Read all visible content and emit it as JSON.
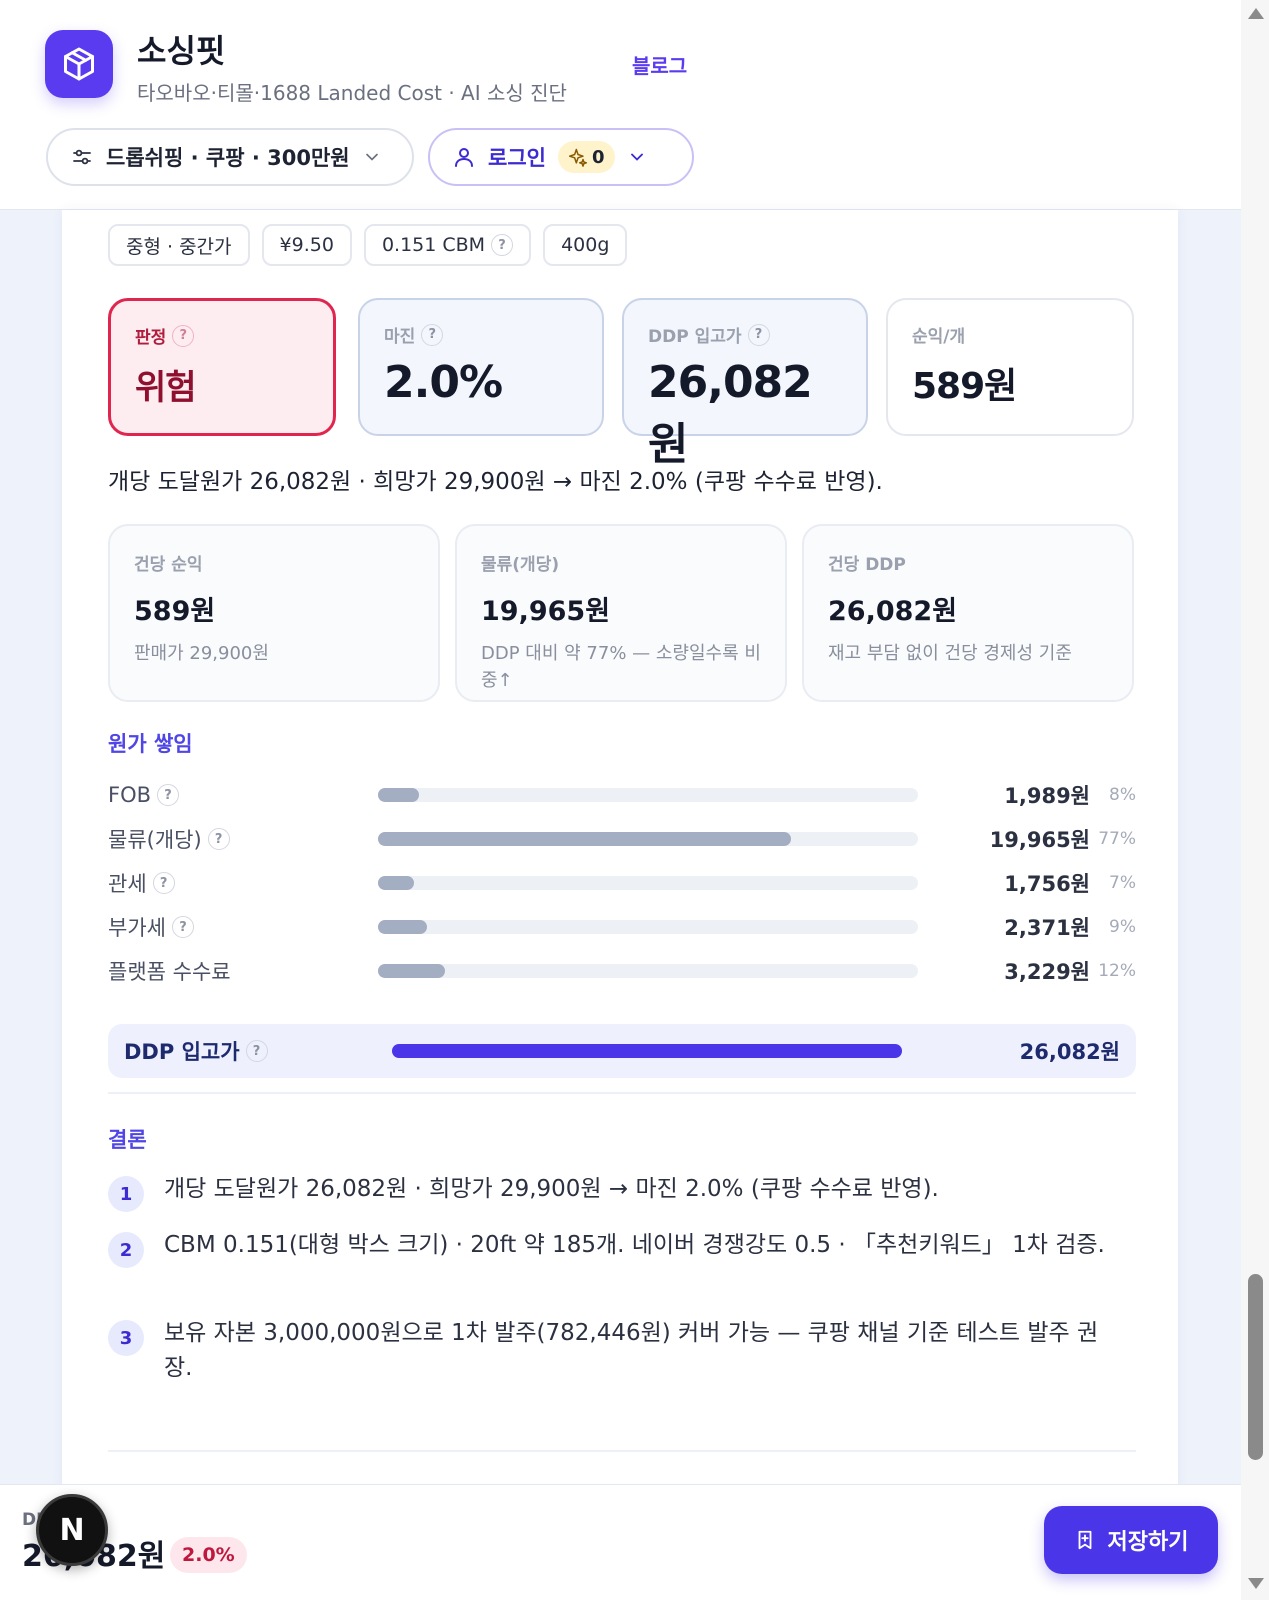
{
  "app": {
    "title": "소싱핏",
    "subtitle": "타오바오·티몰·1688 Landed Cost · AI 소싱 진단",
    "blog_link": "블로그"
  },
  "header": {
    "preset_label": "드롭쉬핑 · 쿠팡 · 300만원",
    "login_label": "로그인",
    "credits": "0"
  },
  "chips": [
    {
      "label": "중형 · 중간가",
      "help": false
    },
    {
      "label": "¥9.50",
      "help": false
    },
    {
      "label": "0.151 CBM",
      "help": true
    },
    {
      "label": "400g",
      "help": false
    }
  ],
  "kpis": {
    "verdict": {
      "label": "판정",
      "value": "위험"
    },
    "margin": {
      "label": "마진",
      "value": "2.0%"
    },
    "ddp": {
      "label": "DDP 입고가",
      "value": "26,082원"
    },
    "net": {
      "label": "순익/개",
      "value": "589원"
    }
  },
  "summary": "개당 도달원가 26,082원 · 희망가 29,900원 → 마진 2.0% (쿠팡 수수료 반영).",
  "stats": [
    {
      "label": "건당 순익",
      "value": "589원",
      "note": "판매가 29,900원"
    },
    {
      "label": "물류(개당)",
      "value": "19,965원",
      "note": "DDP 대비 약 77% — 소량일수록 비중↑"
    },
    {
      "label": "건당 DDP",
      "value": "26,082원",
      "note": "재고 부담 없이 건당 경제성 기준"
    }
  ],
  "cost_stack": {
    "title": "원가 쌓임",
    "rows": [
      {
        "name": "FOB",
        "help": true,
        "amount": "1,989원",
        "pct": "8%",
        "share": 0.076
      },
      {
        "name": "물류(개당)",
        "help": true,
        "amount": "19,965원",
        "pct": "77%",
        "share": 0.765
      },
      {
        "name": "관세",
        "help": true,
        "amount": "1,756원",
        "pct": "7%",
        "share": 0.067
      },
      {
        "name": "부가세",
        "help": true,
        "amount": "2,371원",
        "pct": "9%",
        "share": 0.091
      },
      {
        "name": "플랫폼 수수료",
        "help": false,
        "amount": "3,229원",
        "pct": "12%",
        "share": 0.124
      }
    ],
    "total": {
      "name": "DDP 입고가",
      "amount": "26,082원",
      "share": 1.0
    }
  },
  "conclusion": {
    "title": "결론",
    "items": [
      {
        "num": "1",
        "text": "개당 도달원가 26,082원 · 희망가 29,900원 → 마진 2.0% (쿠팡 수수료 반영)."
      },
      {
        "num": "2",
        "text": "CBM 0.151(대형 박스 크기) · 20ft 약 185개. 네이버 경쟁강도 0.5 · 「추천키워드」 1차 검증."
      },
      {
        "num": "3",
        "text": "보유 자본 3,000,000원으로 1차 발주(782,446원) 커버 가능 — 쿠팡 채널 기준 테스트 발주 권장."
      }
    ]
  },
  "bottom_bar": {
    "label": "DDP 원가",
    "value": "26,082원",
    "margin_badge": "2.0%",
    "save_label": "저장하기",
    "dev_badge": "N"
  },
  "colors": {
    "accent": "#4a35e8",
    "danger": "#e0264e",
    "bar_neutral": "#a4aec3"
  }
}
